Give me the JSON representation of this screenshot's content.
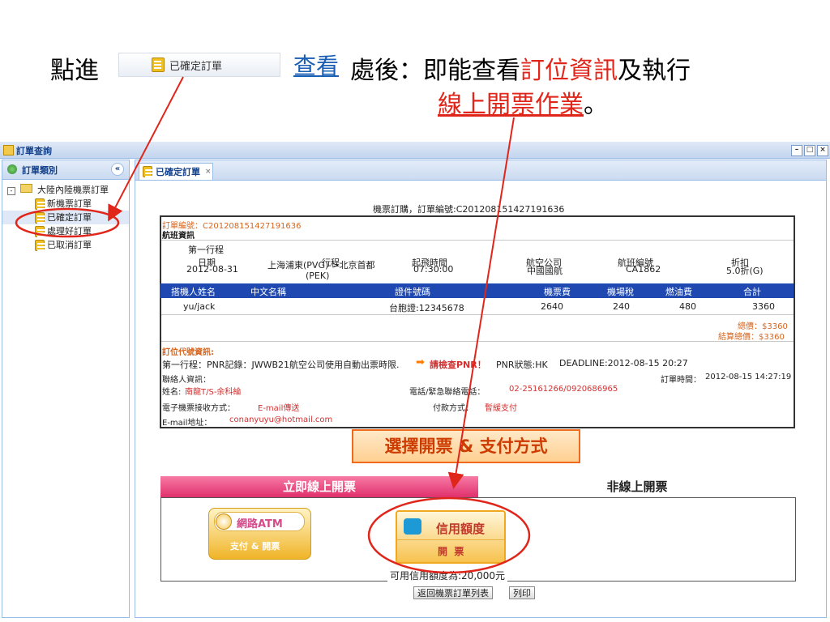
{
  "instruction": {
    "click_into": "點進",
    "chip_label": "已確定訂單",
    "view_link": "查看",
    "after": "處後：即能查看",
    "booking_info": "訂位資訊",
    "and_do": "及執行",
    "online_ticketing": "線上開票作業",
    "period": "。"
  },
  "window": {
    "title": "訂單查詢",
    "controls": [
      "–",
      "□",
      "×"
    ]
  },
  "sidebar": {
    "header": "訂單類別",
    "collapse": "«",
    "group": "大陸內陸機票訂單",
    "items": [
      "新機票訂單",
      "已確定訂單",
      "處理好訂單",
      "已取消訂單"
    ]
  },
  "tab": {
    "label": "已確定訂單",
    "close": "×"
  },
  "order": {
    "header_line": "機票訂購，訂單編號:C201208151427191636",
    "order_no": "訂單編號：C201208151427191636",
    "flight_info_title": "航班資訊",
    "leg_label": "第一行程",
    "columns": [
      "日期",
      "行程",
      "起飛時間",
      "航空公司",
      "航班編號",
      "折扣"
    ],
    "flight_row": {
      "date": "2012-08-31",
      "route_line1": "上海浦東(PVG)->北京首都",
      "route_line2": "(PEK)",
      "depart": "07:30:00",
      "airline": "中國國航",
      "flight_no": "CA1862",
      "discount": "5.0折(G)"
    },
    "pax_columns": [
      "搭機人姓名",
      "中文名稱",
      "證件號碼",
      "機票費",
      "機場稅",
      "燃油費",
      "合計"
    ],
    "pax_row": {
      "name": "yu/jack",
      "cn_name": "",
      "id_no": "台胞證:12345678",
      "fare": "2640",
      "airport_tax": "240",
      "fuel": "480",
      "total": "3360"
    },
    "total_price": "總價：$3360",
    "settle_total": "結算總價：$3360",
    "pnr_title": "訂位代號資訊:",
    "pnr_line": "第一行程：PNR記錄：JWWB21航空公司使用自動出票時限.",
    "pnr_check": "請檢查PNR！",
    "pnr_status": "PNR狀態:HK",
    "deadline": "DEADLINE:2012-08-15 20:27",
    "contact_title": "聯絡人資訊：",
    "order_time_label": "訂單時間：",
    "order_time": "2012-08-15 14:27:19",
    "contact_name_label": "姓名:",
    "contact_name": "南龍T/S-余科綸",
    "phone_label": "電話/緊急聯絡電話：",
    "phone": "02-25161266/0920686965",
    "eticket_label": "電子機票接收方式：",
    "eticket": "E-mail傳送",
    "payment_label": "付款方式：",
    "payment": "暫緩支付",
    "email_label": "E-mail地址：",
    "email": "conanyuyu@hotmail.com"
  },
  "choose_title": "選擇開票 & 支付方式",
  "tabs": {
    "online": "立即線上開票",
    "offline": "非線上開票"
  },
  "atm": {
    "title": "網路ATM",
    "sub": "支付 & 開票"
  },
  "credit": {
    "title": "信用額度",
    "sub": "開  票"
  },
  "credit_limit": "可用信用額度為:20,000元",
  "buttons": {
    "back": "返回機票訂單列表",
    "print": "列印"
  },
  "colors": {
    "accent_red": "#e0261b",
    "header_blue": "#1f49b0",
    "pink_tab": "#e0306c"
  }
}
